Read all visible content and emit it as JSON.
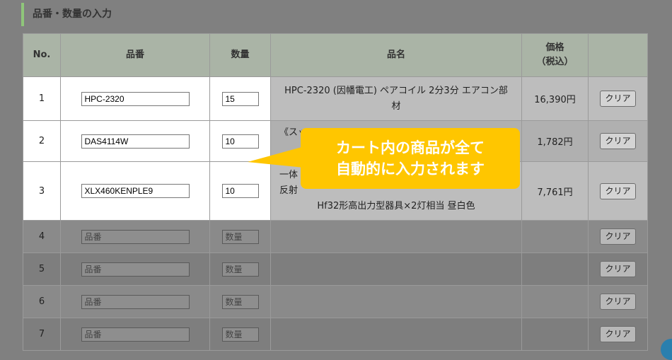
{
  "section_title": "品番・数量の入力",
  "columns": {
    "no": "No.",
    "code": "品番",
    "qty": "数量",
    "name": "品名",
    "price_line1": "価格",
    "price_line2": "（税込）"
  },
  "placeholders": {
    "code": "品番",
    "qty": "数量"
  },
  "clear_label": "クリア",
  "rows": [
    {
      "no": "1",
      "code": "HPC-2320",
      "qty": "15",
      "name_line1": "HPC-2320 (因幡電工) ペアコイル 2分3分 エアコン部",
      "name_line2": "材",
      "price": "16,390円"
    },
    {
      "no": "2",
      "code": "DAS4114W",
      "qty": "10",
      "name_line1": "《スッ",
      "name_line2": "",
      "price": "1,782円"
    },
    {
      "no": "3",
      "code": "XLX460KENPLE9",
      "qty": "10",
      "name_line1": "一体",
      "name_line2": "反射",
      "name_line3": "Hf32形高出力型器具×2灯相当 昼白色",
      "price": "7,761円"
    },
    {
      "no": "4"
    },
    {
      "no": "5"
    },
    {
      "no": "6"
    },
    {
      "no": "7"
    }
  ],
  "callout": {
    "line1": "カート内の商品が全て",
    "line2": "自動的に入力されます"
  },
  "colors": {
    "accent": "#8fc67a",
    "callout": "#ffc600",
    "header_bg": "#aab4a6"
  }
}
